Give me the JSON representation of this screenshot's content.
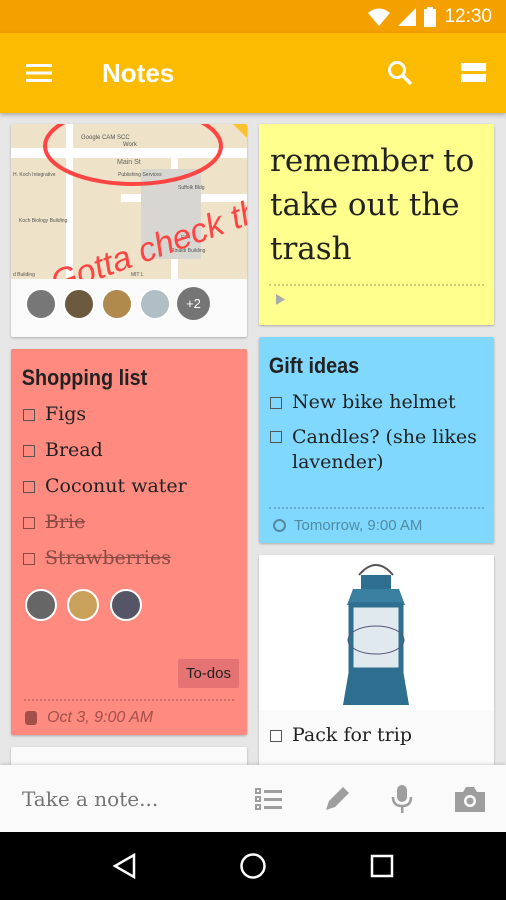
{
  "status_bar": {
    "time": "12:30",
    "icons": [
      "wifi-icon",
      "signal-icon",
      "battery-icon"
    ]
  },
  "app_bar": {
    "title": "Notes",
    "icons": [
      "menu-icon",
      "search-icon",
      "list-view-icon"
    ]
  },
  "colors": {
    "app_bar": "#fbbb00",
    "status_bar": "#f4a000",
    "yellow_note": "#ffff8d",
    "red_note": "#ff8a80",
    "blue_note": "#80d8ff"
  },
  "map_note": {
    "map_labels": [
      "Google CAM SCC",
      "Work",
      "Main St",
      "Publishing Services",
      "H. Koch Integrative",
      "Suffolk Bldg",
      "Koch Biology Building",
      "E34",
      "Rinaldi Building",
      "d Building",
      "MIT L"
    ],
    "handwriting": "Gotta check the atrium!",
    "more_collaborators": "+2"
  },
  "reminder_note": {
    "text": "remember to take out the trash"
  },
  "shopping": {
    "title": "Shopping list",
    "items": [
      {
        "text": "Figs",
        "checked": false
      },
      {
        "text": "Bread",
        "checked": false
      },
      {
        "text": "Coconut water",
        "checked": false
      },
      {
        "text": "Brie",
        "checked": true
      },
      {
        "text": "Strawberries",
        "checked": true
      }
    ],
    "label": "To-dos",
    "reminder": "Oct 3, 9:00 AM"
  },
  "gift": {
    "title": "Gift ideas",
    "items": [
      {
        "text": "New bike helmet",
        "checked": false
      },
      {
        "text": "Candles? (she likes lavender)",
        "checked": false
      }
    ],
    "reminder": "Tomorrow, 9:00 AM"
  },
  "lantern": {
    "items": [
      {
        "text": "Pack for trip",
        "checked": false
      }
    ]
  },
  "bottom_bar": {
    "placeholder": "Take a note...",
    "icons": [
      "checklist-icon",
      "pen-icon",
      "mic-icon",
      "camera-icon"
    ]
  },
  "nav": {
    "icons": [
      "back-icon",
      "home-icon",
      "recents-icon"
    ]
  }
}
